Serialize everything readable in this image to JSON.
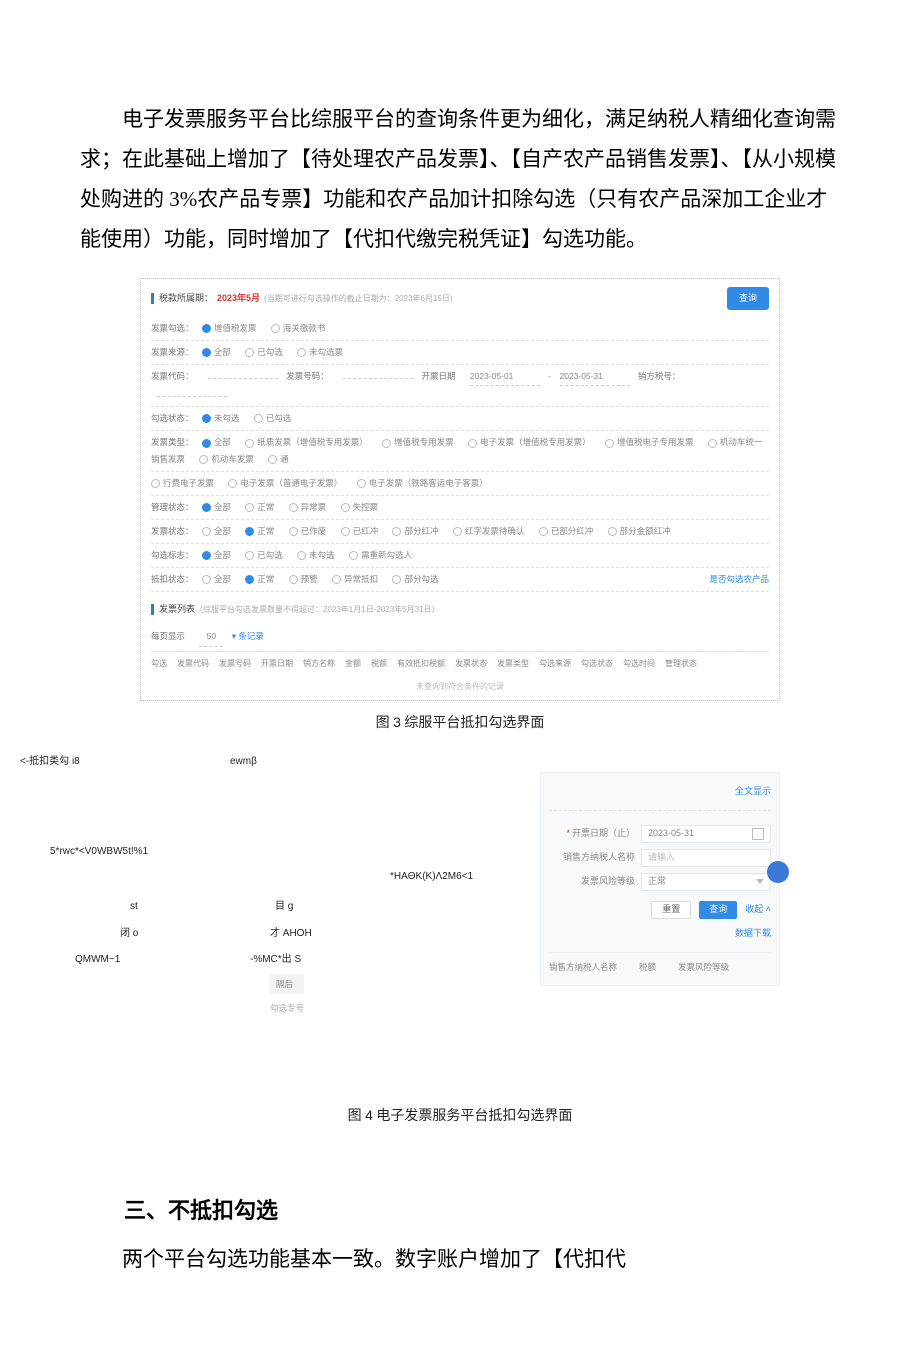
{
  "paragraph1": "电子发票服务平台比综服平台的查询条件更为细化，满足纳税人精细化查询需求；在此基础上增加了【待处理农产品发票】、【自产农产品销售发票】、【从小规模处购进的 3%农产品专票】功能和农产品加计扣除勾选（只有农产品深加工企业才能使用）功能，同时增加了【代扣代缴完税凭证】勾选功能。",
  "fig3": {
    "section_title": "税款所属期：",
    "period": "2023年5月",
    "hint": "(当期可进行勾选操作的截止日期为：2023年6月15日)",
    "button": "查询",
    "rows": {
      "r1": {
        "label": "发票勾选：",
        "opts": [
          "增值税发票",
          "海关缴款书"
        ]
      },
      "r2": {
        "label": "发票来源：",
        "opts": [
          "全部",
          "已勾选",
          "未勾选票"
        ]
      },
      "r3": {
        "label": "发票代码：",
        "col2_label": "发票号码：",
        "col3_label": "开票日期",
        "date_from": "2023-05-01",
        "date_to": "2023-05-31",
        "col4_label": "销方税号："
      },
      "r4": {
        "label": "勾选状态：",
        "opts": [
          "未勾选",
          "已勾选"
        ]
      },
      "r5": {
        "label": "发票类型：",
        "opts": [
          "全部",
          "纸质发票（增值税专用发票）",
          "增值税专用发票",
          "电子发票（增值税专用发票）",
          "增值税电子专用发票",
          "机动车统一销售发票",
          "机动车发票",
          "通"
        ]
      },
      "r5b": {
        "opts2": [
          "行费电子发票",
          "电子发票（普通电子发票）",
          "电子发票（铁路客运电子客票）"
        ]
      },
      "r6": {
        "label": "管理状态：",
        "opts": [
          "全部",
          "正常",
          "异常票",
          "失控票"
        ]
      },
      "r7": {
        "label": "发票状态：",
        "opts": [
          "全部",
          "正常",
          "已作废",
          "已红冲",
          "部分红冲",
          "红字发票待确认",
          "已部分红冲",
          "部分金额红冲"
        ]
      },
      "r8": {
        "label": "勾选标志：",
        "opts": [
          "全部",
          "已勾选",
          "未勾选",
          "需重新勾选人"
        ]
      },
      "r9": {
        "label": "抵扣状态：",
        "opts": [
          "全部",
          "正常",
          "预警",
          "异常抵扣",
          "部分勾选"
        ],
        "right_link": "是否勾选农产品"
      }
    },
    "section2_title": "发票列表",
    "section2_hint": "（综服平台勾选发票数量不得超过：2023年1月1日-2023年5月31日）",
    "pager": {
      "label": "每页显示",
      "value": "50",
      "unit": "条记录"
    },
    "thead": [
      "勾选",
      "发票代码",
      "发票号码",
      "开票日期",
      "销方名称",
      "金额",
      "税额",
      "有效抵扣税额",
      "发票状态",
      "发票类型",
      "勾选来源",
      "勾选状态",
      "勾选时间",
      "管理状态"
    ],
    "empty": "未查询到符合条件的记录"
  },
  "caption3": {
    "prefix": "图",
    "num": "3",
    "text": "综服平台抵扣勾选界面"
  },
  "fig4_garble": {
    "g1": "<-抵扣类勾 i8",
    "g2": "ewmβ",
    "g3": "5*rwc*<V0WBW5t!%1",
    "g4": "*HAΘK(K)Λ2M6<1",
    "g5": "st",
    "g6": "目 g",
    "g7": "闭 o",
    "g8": "才 AHOH",
    "g9": "QMWM~1",
    "g10": "-%MC*出 S"
  },
  "fig4_left": {
    "c1": "隔后",
    "c2": "勾选专号"
  },
  "fig4_panel": {
    "top_link": "全文显示",
    "date_label": "开票日期（止）",
    "date_value": "2023-05-31",
    "seller_label": "销售方纳税人名称",
    "seller_placeholder": "请输入",
    "risk_label": "发票风险等级",
    "risk_value": "正常",
    "btn_reset": "重置",
    "btn_query": "查询",
    "btn_fold": "收起 ˄",
    "download": "数据下载",
    "thead": [
      "销售方纳税人名称",
      "税额",
      "发票风险等级"
    ]
  },
  "caption4": {
    "prefix": "图",
    "num": "4",
    "text": "电子发票服务平台抵扣勾选界面"
  },
  "section3_title": "三、不抵扣勾选",
  "paragraph2": "两个平台勾选功能基本一致。数字账户增加了【代扣代"
}
